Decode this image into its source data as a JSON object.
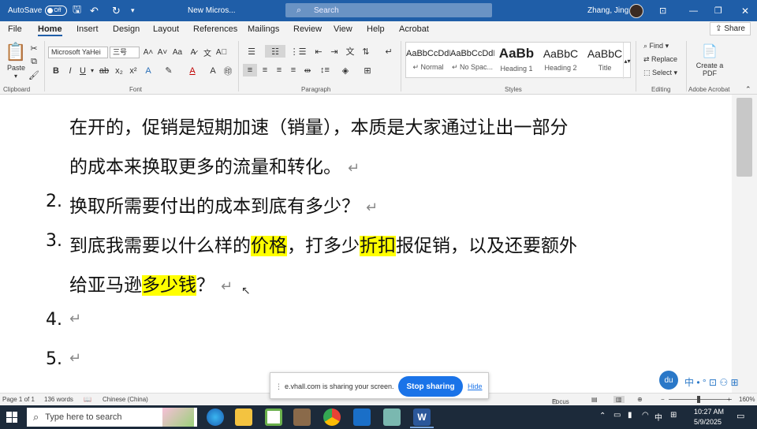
{
  "titlebar": {
    "autosave_label": "AutoSave",
    "autosave_state": "Off",
    "doc_title": "New Micros...",
    "search_placeholder": "Search",
    "user_name": "Zhang, Jing"
  },
  "menu": {
    "tabs": [
      "File",
      "Home",
      "Insert",
      "Design",
      "Layout",
      "References",
      "Mailings",
      "Review",
      "View",
      "Help",
      "Acrobat"
    ],
    "active": "Home",
    "share_label": "Share"
  },
  "ribbon": {
    "paste_label": "Paste",
    "font_name": "Microsoft YaHei",
    "font_size": "三号",
    "groups": {
      "clipboard": "Clipboard",
      "font": "Font",
      "paragraph": "Paragraph",
      "styles": "Styles",
      "editing": "Editing",
      "adobe": "Adobe Acrobat"
    },
    "styles": [
      {
        "preview": "AaBbCcDdI",
        "name": "↵ Normal"
      },
      {
        "preview": "AaBbCcDdI",
        "name": "↵ No Spac..."
      },
      {
        "preview": "AaBb",
        "name": "Heading 1"
      },
      {
        "preview": "AaBbC",
        "name": "Heading 2"
      },
      {
        "preview": "AaBbC",
        "name": "Title"
      }
    ],
    "editing": {
      "find": "Find",
      "replace": "Replace",
      "select": "Select"
    },
    "create_pdf": "Create a PDF"
  },
  "document": {
    "line1": "在开的，促销是短期加速（销量），本质是大家通过让出一部分",
    "line2": "的成本来换取更多的流量和转化。",
    "item2_num": "2.",
    "item2": "换取所需要付出的成本到底有多少？",
    "item3_num": "3.",
    "item3_a": "到底我需要以什么样的",
    "item3_hl1": "价格",
    "item3_b": "，打多少",
    "item3_hl2": "折扣",
    "item3_c": "报促销，以及还要额外",
    "item3_line2a": "给亚马逊",
    "item3_hl3": "多少钱",
    "item3_line2b": "？",
    "item4_num": "4.",
    "item5_num": "5.",
    "para_mark": "↵"
  },
  "statusbar": {
    "page": "Page 1 of 1",
    "words": "136 words",
    "language": "Chinese (China)",
    "focus": "Focus",
    "zoom": "160%"
  },
  "sharebar": {
    "message": "e.vhall.com is sharing your screen.",
    "stop_label": "Stop sharing",
    "hide_label": "Hide"
  },
  "taskbar": {
    "search_placeholder": "Type here to search",
    "time": "10:27 AM",
    "date": "5/9/2025",
    "ime_char": "中"
  },
  "colors": {
    "title_bar": "#1f5ea8",
    "highlight": "#ffff00",
    "stop_button": "#1a73e8",
    "taskbar": "#1c2a3a"
  }
}
